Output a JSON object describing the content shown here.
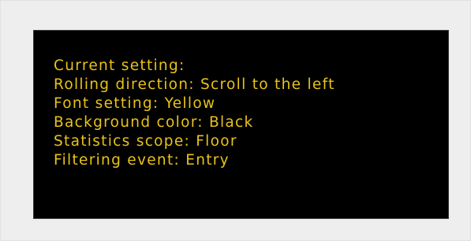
{
  "display": {
    "text_color": "#e8c21a",
    "background_color": "#000000",
    "lines": [
      "Current setting:",
      "Rolling direction: Scroll to the left",
      "Font setting: Yellow",
      "Background color: Black",
      "Statistics scope: Floor",
      "Filtering event: Entry"
    ]
  }
}
